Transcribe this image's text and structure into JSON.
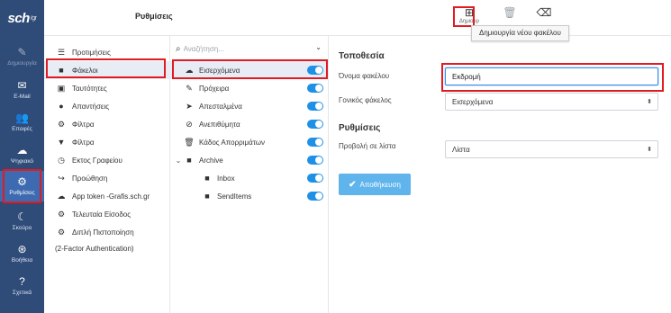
{
  "app": {
    "logo": "sch",
    "logo_suffix": "/gr"
  },
  "header": {
    "title": "Ρυθμίσεις"
  },
  "toolbar": {
    "create": {
      "icon": "plus-square-icon",
      "label": "Δημιουρ"
    },
    "delete": {
      "icon": "trash-icon"
    },
    "purge": {
      "icon": "eraser-icon"
    },
    "tooltip": "Δημιουργία νέου φακέλου"
  },
  "rail": [
    {
      "name": "compose",
      "icon": "pen-icon",
      "label": "Δημιουργία"
    },
    {
      "name": "mail",
      "icon": "envelope-icon",
      "label": "E-Mail"
    },
    {
      "name": "contacts",
      "icon": "users-icon",
      "label": "Επαφές"
    },
    {
      "name": "cloud",
      "icon": "cloud-icon",
      "label": "Ψηφιακό"
    },
    {
      "name": "settings",
      "icon": "gear-icon",
      "label": "Ρυθμίσεις"
    },
    {
      "name": "theme",
      "icon": "moon-icon",
      "label": "Σκούρο"
    },
    {
      "name": "help",
      "icon": "lifebuoy-icon",
      "label": "Βοήθεια"
    },
    {
      "name": "about",
      "icon": "question-icon",
      "label": "Σχετικά"
    }
  ],
  "settings_menu": [
    {
      "icon": "sliders-icon",
      "label": "Προτιμήσεις"
    },
    {
      "icon": "folder-icon",
      "label": "Φάκελοι"
    },
    {
      "icon": "id-card-icon",
      "label": "Ταυτότητες"
    },
    {
      "icon": "comment-icon",
      "label": "Απαντήσεις"
    },
    {
      "icon": "gear-icon",
      "label": "Φίλτρα"
    },
    {
      "icon": "filter-icon",
      "label": "Φίλτρα"
    },
    {
      "icon": "clock-icon",
      "label": "Εκτος Γραφείου"
    },
    {
      "icon": "forward-icon",
      "label": "Προώθηση"
    },
    {
      "icon": "cloud-icon",
      "label": "App token -Grafis.sch.gr"
    },
    {
      "icon": "gear-icon",
      "label": "Τελευταία Είσοδος"
    },
    {
      "icon": "gear-icon",
      "label": "Διπλή Πιστοποίηση"
    }
  ],
  "settings_menu_note": "(2-Factor Authentication)",
  "folders": {
    "search_placeholder": "Αναζήτηση...",
    "items": [
      {
        "icon": "inbox-icon",
        "label": "Εισερχόμενα",
        "level": 0
      },
      {
        "icon": "pencil-icon",
        "label": "Πρόχειρα",
        "level": 0
      },
      {
        "icon": "paper-plane-icon",
        "label": "Απεσταλμένα",
        "level": 0
      },
      {
        "icon": "ban-icon",
        "label": "Ανεπιθύμητα",
        "level": 0
      },
      {
        "icon": "trash-icon",
        "label": "Κάδος Απορριμάτων",
        "level": 0
      },
      {
        "icon": "folder-icon",
        "label": "Archive",
        "level": 0
      },
      {
        "icon": "folder-icon",
        "label": "Inbox",
        "level": 1
      },
      {
        "icon": "folder-icon",
        "label": "SendItems",
        "level": 1
      }
    ]
  },
  "form": {
    "location_title": "Τοποθεσία",
    "folder_name_label": "Όνομα φακέλου",
    "folder_name_value": "Εκδρομή",
    "parent_label": "Γονικός φάκελος",
    "parent_value": "Εισερχόμενα",
    "settings_title": "Ρυθμίσεις",
    "view_label": "Προβολή σε λίστα",
    "view_value": "Λίστα",
    "save_label": "Αποθήκευση"
  },
  "colors": {
    "rail": "#2f4b78",
    "rail_active": "#3d6ab0",
    "accent": "#1e90e6",
    "highlight": "#e11b22"
  }
}
